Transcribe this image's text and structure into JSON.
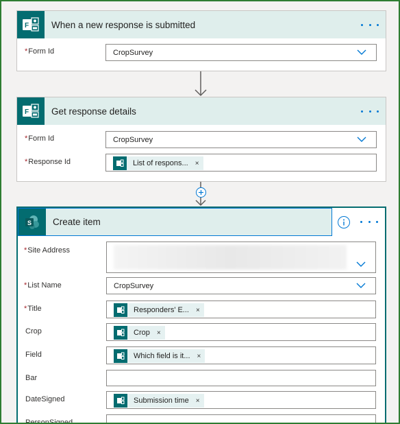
{
  "trigger": {
    "title": "When a new response is submitted",
    "form_id_label": "Form Id",
    "form_id_value": "CropSurvey"
  },
  "get_details": {
    "title": "Get response details",
    "form_id_label": "Form Id",
    "form_id_value": "CropSurvey",
    "response_id_label": "Response Id",
    "response_id_token": "List of respons..."
  },
  "create_item": {
    "title": "Create item",
    "site_address_label": "Site Address",
    "list_name_label": "List Name",
    "list_name_value": "CropSurvey",
    "title_label": "Title",
    "title_token": "Responders' E...",
    "crop_label": "Crop",
    "crop_token": "Crop",
    "field_label": "Field",
    "field_token": "Which field is it...",
    "bar_label": "Bar",
    "date_signed_label": "DateSigned",
    "date_signed_token": "Submission time",
    "person_signed_label": "PersonSigned"
  },
  "remove_symbol": "×",
  "icons": {
    "forms": "forms-icon",
    "sharepoint": "sharepoint-icon",
    "more": "more-options-icon",
    "info": "info-icon",
    "chevron": "chevron-down-icon",
    "add_step": "add-step-icon"
  },
  "colors": {
    "accent": "#0078d4",
    "forms_teal": "#036c70",
    "header_bg": "#dfeeec",
    "required": "#a4262c"
  }
}
